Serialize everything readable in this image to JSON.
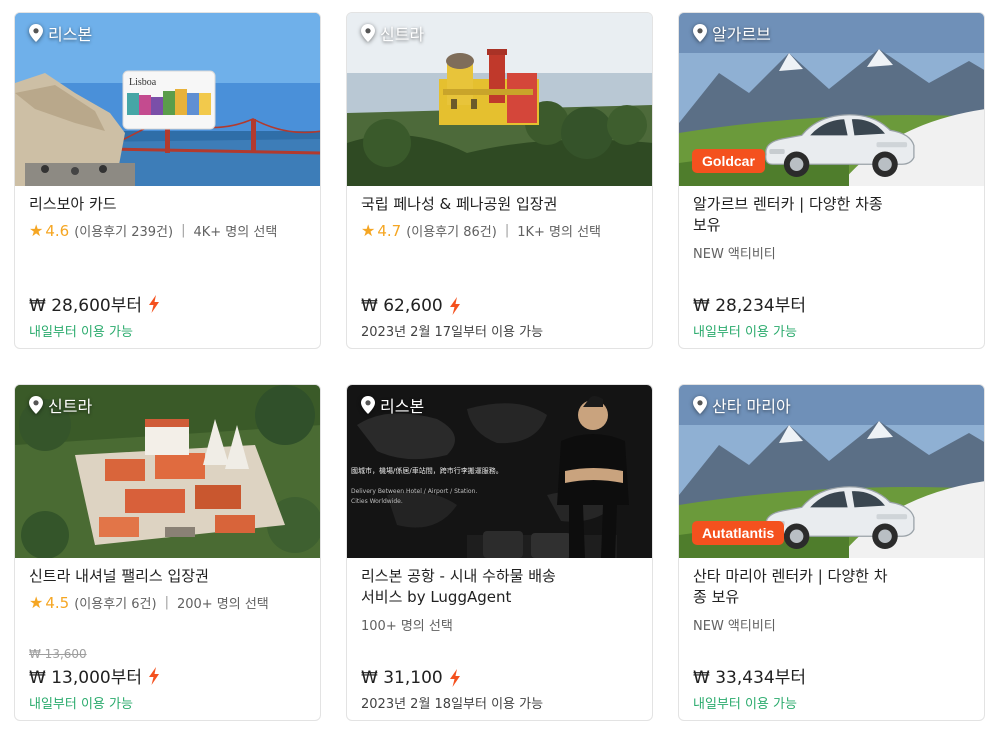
{
  "cards": [
    {
      "location": "리스본",
      "image_icon": "lisboa-card-photo",
      "title": "리스보아 카드",
      "rating": "4.6",
      "reviews": "(이용후기 239건)",
      "separator": "|",
      "selected": "4K+ 명의 선택",
      "price": "₩ 28,600부터",
      "instant_icon": "lightning-icon",
      "availability": "내일부터 이용 가능"
    },
    {
      "location": "신트라",
      "image_icon": "pena-palace-photo",
      "title": "국립 페나성 & 페나공원 입장권",
      "rating": "4.7",
      "reviews": "(이용후기 86건)",
      "separator": "|",
      "selected": "1K+ 명의 선택",
      "price": "₩ 62,600",
      "instant_icon": "lightning-icon",
      "availability": "2023년 2월 17일부터 이용 가능"
    },
    {
      "location": "알가르브",
      "image_icon": "rental-car-photo",
      "partner": "Goldcar",
      "title_line1": "알가르브 렌터카 | 다양한 차종",
      "title_line2": "보유",
      "tag": "NEW 액티비티",
      "price": "₩ 28,234부터",
      "availability": "내일부터 이용 가능"
    },
    {
      "location": "신트라",
      "image_icon": "sintra-palace-photo",
      "title": "신트라 내셔널 팰리스 입장권",
      "rating": "4.5",
      "reviews": "(이용후기 6건)",
      "separator": "|",
      "selected": "200+ 명의 선택",
      "original_price": "₩ 13,600",
      "price": "₩ 13,000부터",
      "instant_icon": "lightning-icon",
      "availability": "내일부터 이용 가능"
    },
    {
      "location": "리스본",
      "image_icon": "luggage-delivery-photo",
      "photo_text1": "國城市，機場/係居/車站間，跨市行李搬運服務。",
      "photo_text2": "Delivery Between Hotel / Airport / Station.",
      "photo_text3": "Cities Worldwide.",
      "title_line1": "리스본 공항 - 시내 수하물 배송",
      "title_line2": "서비스 by LuggAgent",
      "selected": "100+ 명의 선택",
      "price": "₩ 31,100",
      "instant_icon": "lightning-icon",
      "availability": "2023년 2월 18일부터 이용 가능"
    },
    {
      "location": "산타 마리아",
      "image_icon": "rental-car-photo",
      "partner": "Autatlantis",
      "title_line1": "산타 마리아 렌터카 | 다양한 차",
      "title_line2": "종 보유",
      "tag": "NEW 액티비티",
      "price": "₩ 33,434부터",
      "availability": "내일부터 이용 가능"
    }
  ],
  "colors": {
    "accent": "#f4511e",
    "rating": "#f5a623",
    "available": "#2bab6d"
  }
}
